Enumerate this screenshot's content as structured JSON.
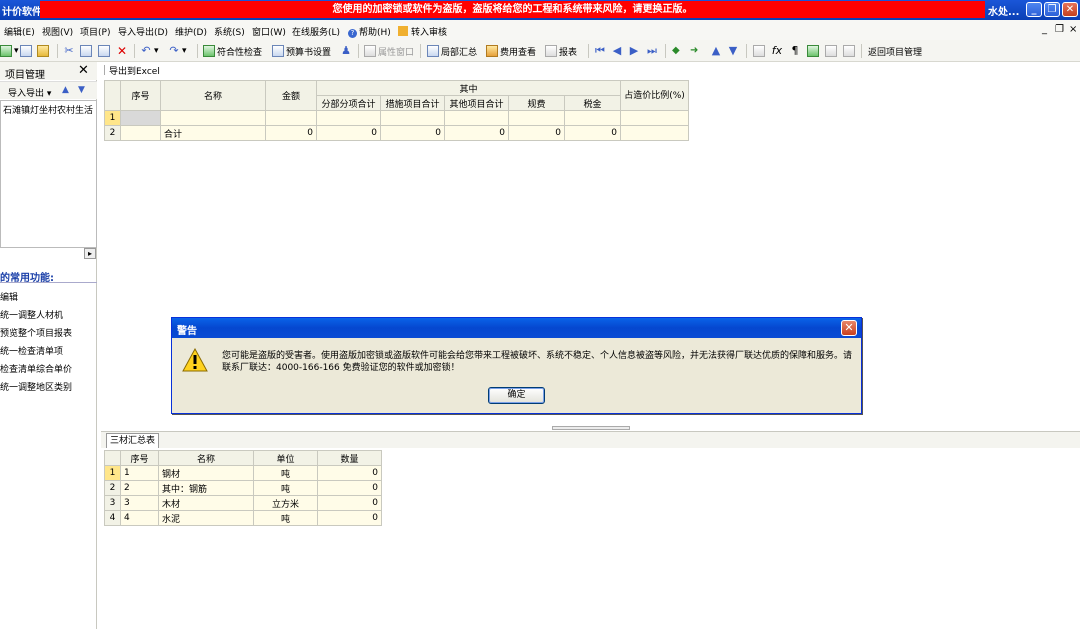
{
  "titlebar": {
    "app_name": "计价软件",
    "warning_banner": "您使用的加密锁或软件为盗版，盗版将给您的工程和系统带来风险，请更换正版。",
    "right_title": "水处..."
  },
  "menubar": {
    "items": [
      "编辑(E)",
      "视图(V)",
      "项目(P)",
      "导入导出(D)",
      "维护(D)",
      "系统(S)",
      "窗口(W)",
      "在线服务(L)",
      "帮助(H)",
      "转入审核"
    ]
  },
  "toolbar": {
    "compliance_check": "符合性检查",
    "budget_settings": "预算书设置",
    "property_window": "属性窗口",
    "partial_summary": "局部汇总",
    "fee_view": "费用查看",
    "report": "报表",
    "return_project_mgmt": "返回项目管理"
  },
  "left_panel": {
    "title": "项目管理",
    "import_export": "导入导出",
    "tree_node": "石滩镇灯坐村农村生活",
    "common_funcs_title": "的常用功能:",
    "funcs": [
      "编辑",
      "统一调整人材机",
      "预览整个项目报表",
      "统一检查清单项",
      "检查清单综合单价",
      "统一调整地区类别"
    ]
  },
  "main": {
    "export_excel": "导出到Excel",
    "top_grid": {
      "headers": {
        "seq": "序号",
        "name": "名称",
        "amount": "金额",
        "of_which": "其中",
        "sub_items": [
          "分部分项合计",
          "措施项目合计",
          "其他项目合计",
          "规费",
          "税金"
        ],
        "ratio": "占造价比例(%)"
      },
      "rows": [
        {
          "num": "1",
          "seq": "",
          "name": "",
          "amount": "",
          "v1": "",
          "v2": "",
          "v3": "",
          "v4": "",
          "v5": "",
          "ratio": ""
        },
        {
          "num": "2",
          "seq": "",
          "name": "合计",
          "amount": "0",
          "v1": "0",
          "v2": "0",
          "v3": "0",
          "v4": "0",
          "v5": "0",
          "ratio": ""
        }
      ]
    },
    "bottom_tab": "三材汇总表",
    "bottom_grid": {
      "headers": {
        "seq": "序号",
        "name": "名称",
        "unit": "单位",
        "qty": "数量"
      },
      "rows": [
        {
          "num": "1",
          "seq": "1",
          "name": "钢材",
          "unit": "吨",
          "qty": "0"
        },
        {
          "num": "2",
          "seq": "2",
          "name": "其中：钢筋",
          "unit": "吨",
          "qty": "0"
        },
        {
          "num": "3",
          "seq": "3",
          "name": "木材",
          "unit": "立方米",
          "qty": "0"
        },
        {
          "num": "4",
          "seq": "4",
          "name": "水泥",
          "unit": "吨",
          "qty": "0"
        }
      ]
    }
  },
  "dialog": {
    "title": "警告",
    "message": "您可能是盗版的受害者。使用盗版加密锁或盗版软件可能会给您带来工程被破坏、系统不稳定、个人信息被盗等风险，并无法获得厂联达优质的保障和服务。请联系厂联达：4000-166-166 免费验证您的软件或加密锁！",
    "ok_label": "确定"
  }
}
